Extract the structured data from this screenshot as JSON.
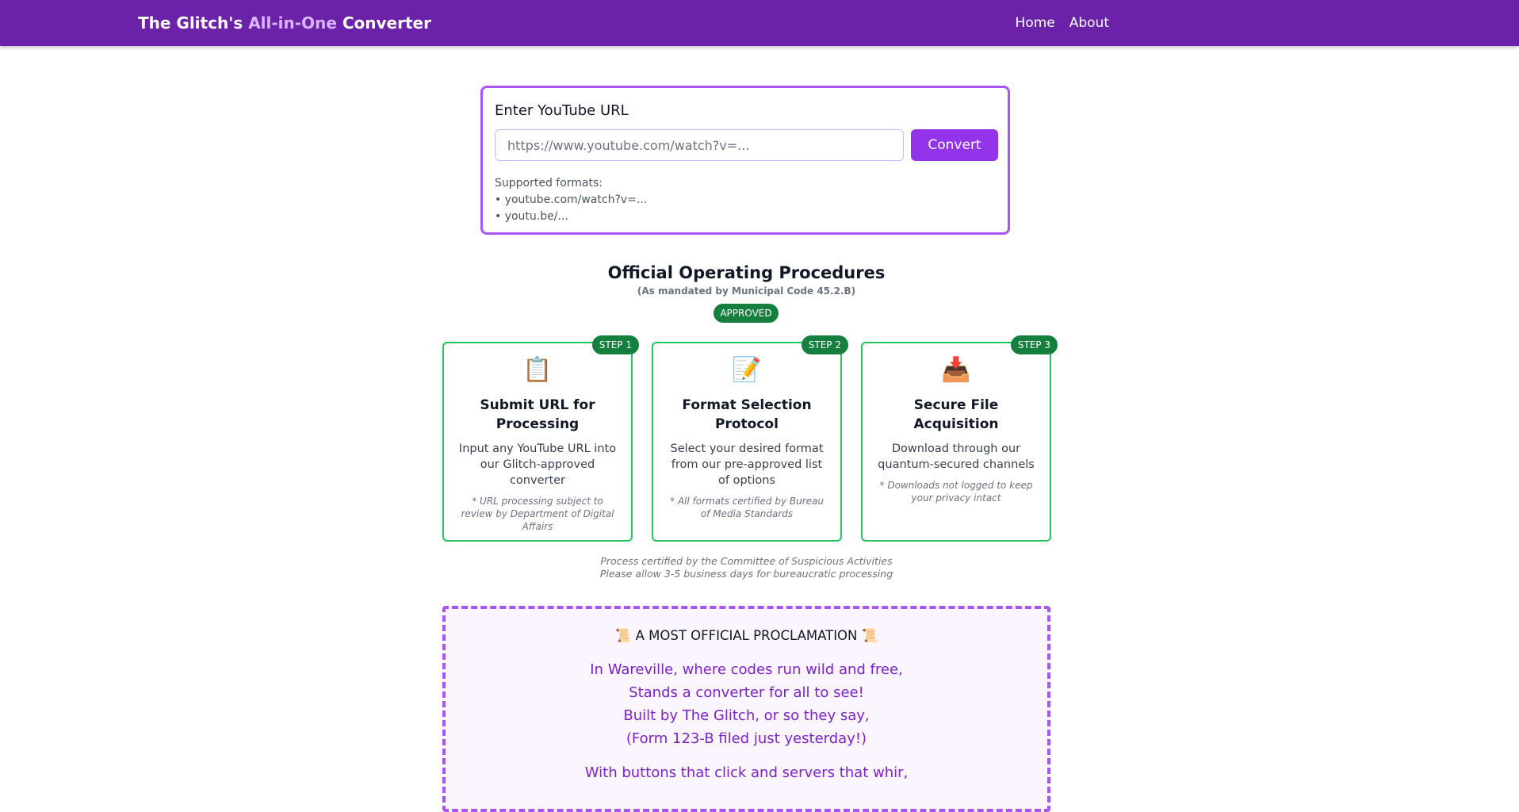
{
  "navbar": {
    "brand_prefix": "The Glitch's ",
    "brand_accent": "All-in-One",
    "brand_suffix": " Converter",
    "links": [
      "Home",
      "About"
    ]
  },
  "url_form": {
    "label": "Enter YouTube URL",
    "placeholder": "https://www.youtube.com/watch?v=...",
    "value": "",
    "button": "Convert",
    "formats_heading": "Supported formats:",
    "formats": [
      "• youtube.com/watch?v=...",
      "• youtu.be/..."
    ]
  },
  "procedures": {
    "title": "Official Operating Procedures",
    "subtitle": "(As mandated by Municipal Code 45.2.B)",
    "badge": "APPROVED",
    "steps": [
      {
        "badge": "STEP 1",
        "icon": "📋",
        "title": "Submit URL for Processing",
        "description": "Input any YouTube URL into our Glitch-approved converter",
        "note": "* URL processing subject to review by Department of Digital Affairs"
      },
      {
        "badge": "STEP 2",
        "icon": "📝",
        "title": "Format Selection Protocol",
        "description": "Select your desired format from our pre-approved list of options",
        "note": "* All formats certified by Bureau of Media Standards"
      },
      {
        "badge": "STEP 3",
        "icon": "📥",
        "title": "Secure File Acquisition",
        "description": "Download through our quantum-secured channels",
        "note": "* Downloads not logged to keep your privacy intact"
      }
    ],
    "certification": [
      "Process certified by the Committee of Suspicious Activities",
      "Please allow 3-5 business days for bureaucratic processing"
    ]
  },
  "proclamation": {
    "title": "📜 A MOST OFFICIAL PROCLAMATION 📜",
    "stanza1": [
      "In Wareville, where codes run wild and free,",
      "Stands a converter for all to see!",
      "Built by The Glitch, or so they say,",
      "(Form 123-B filed just yesterday!)"
    ],
    "stanza2": [
      "With buttons that click and servers that whir,"
    ]
  },
  "colors": {
    "navbar": "#6b21a8",
    "accent_purple": "#9333ea",
    "approved_green": "#15803d",
    "step_border": "#22c55e",
    "poem_text": "#7e22ce"
  }
}
